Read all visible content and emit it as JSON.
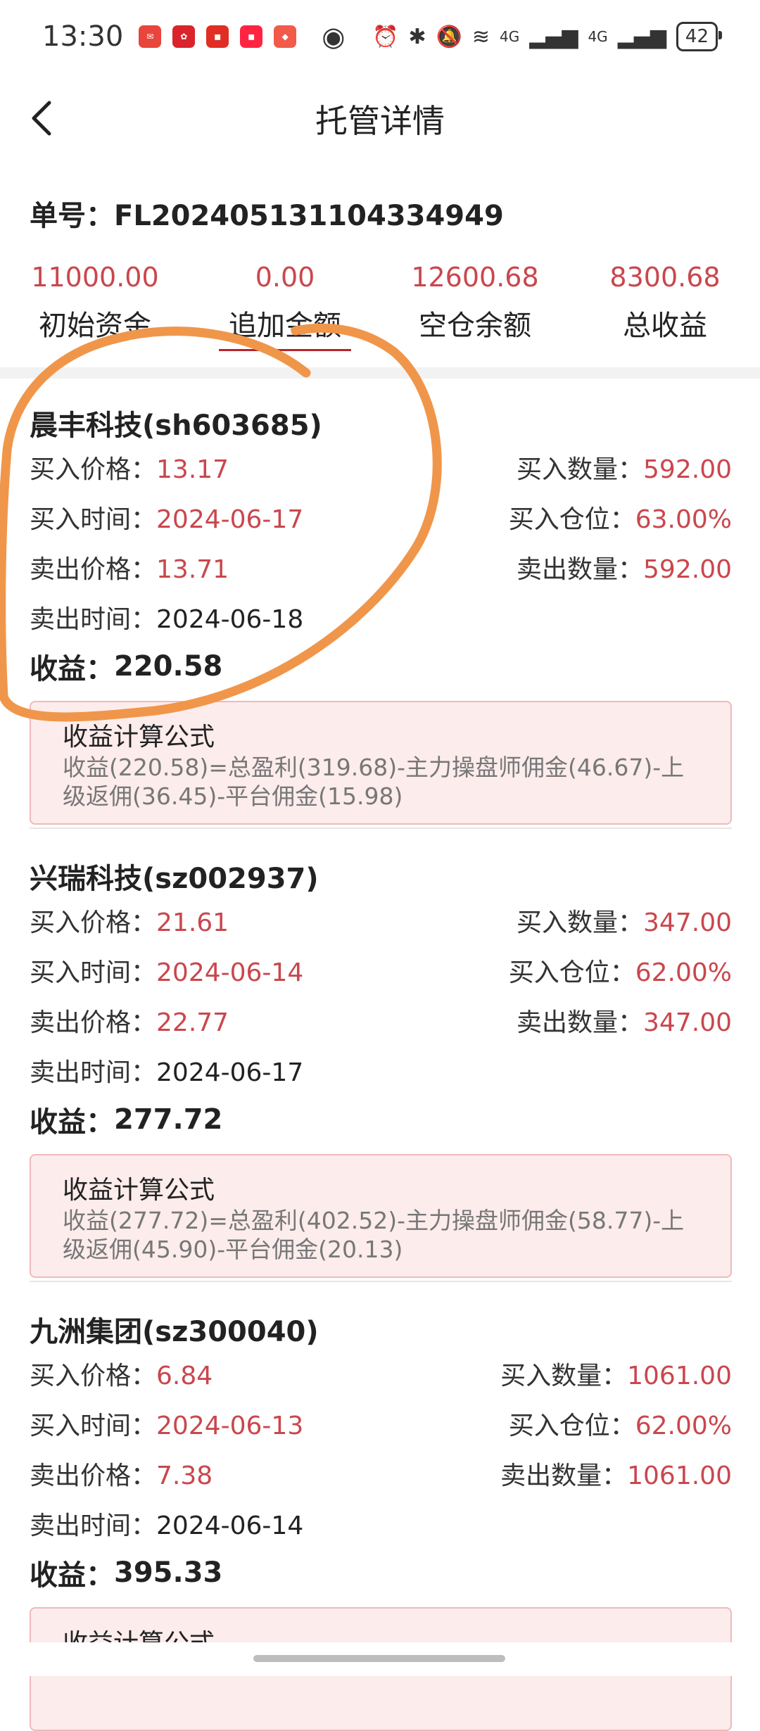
{
  "status": {
    "time": "13:30",
    "network_1": "4G",
    "network_2": "4G",
    "battery": "42",
    "apps": [
      {
        "icon": "red-envelope-app-icon",
        "color": "#e8453c"
      },
      {
        "icon": "red-flower-app-icon",
        "color": "#d9242c"
      },
      {
        "icon": "pinduoduo-app-icon",
        "color": "#e02e24"
      },
      {
        "icon": "xiaohongshu-app-icon",
        "color": "#ff2442"
      },
      {
        "icon": "game-app-icon",
        "color": "#f25a4a"
      }
    ]
  },
  "header": {
    "title": "托管详情",
    "back_icon": "chevron-left-icon"
  },
  "order": {
    "label": "单号：",
    "number": "FL20240513110433494 9"
  },
  "summary": [
    {
      "value": "11000.00",
      "label": "初始资金"
    },
    {
      "value": "0.00",
      "label": "追加金额"
    },
    {
      "value": "12600.68",
      "label": "空仓余额"
    },
    {
      "value": "8300.68",
      "label": "总收益"
    }
  ],
  "labels": {
    "buy_price": "买入价格：",
    "buy_qty": "买入数量：",
    "buy_time": "买入时间：",
    "buy_pos": "买入仓位：",
    "sell_price": "卖出价格：",
    "sell_qty": "卖出数量：",
    "sell_time": "卖出时间：",
    "profit": "收益：",
    "formula_title": "收益计算公式"
  },
  "trades": [
    {
      "name": "晨丰科技(sh603685)",
      "buy_price": "13.17",
      "buy_qty": "592.00",
      "buy_time": "2024-06-17",
      "buy_pos": "63.00%",
      "sell_price": "13.71",
      "sell_qty": "592.00",
      "sell_time": "2024-06-18",
      "profit": "220.58",
      "formula_1": "收益(220.58)=总盈利(319.68)-主力操盘师佣金(46.67)-上",
      "formula_2": "级返佣(36.45)-平台佣金(15.98)"
    },
    {
      "name": "兴瑞科技(sz002937)",
      "buy_price": "21.61",
      "buy_qty": "347.00",
      "buy_time": "2024-06-14",
      "buy_pos": "62.00%",
      "sell_price": "22.77",
      "sell_qty": "347.00",
      "sell_time": "2024-06-17",
      "profit": "277.72",
      "formula_1": "收益(277.72)=总盈利(402.52)-主力操盘师佣金(58.77)-上",
      "formula_2": "级返佣(45.90)-平台佣金(20.13)"
    },
    {
      "name": "九洲集团(sz300040)",
      "buy_price": "6.84",
      "buy_qty": "1061.00",
      "buy_time": "2024-06-13",
      "buy_pos": "62.00%",
      "sell_price": "7.38",
      "sell_qty": "1061.00",
      "sell_time": "2024-06-14",
      "profit": "395.33",
      "formula_1": "",
      "formula_2": ""
    }
  ],
  "annotation_color": "#f0964a"
}
